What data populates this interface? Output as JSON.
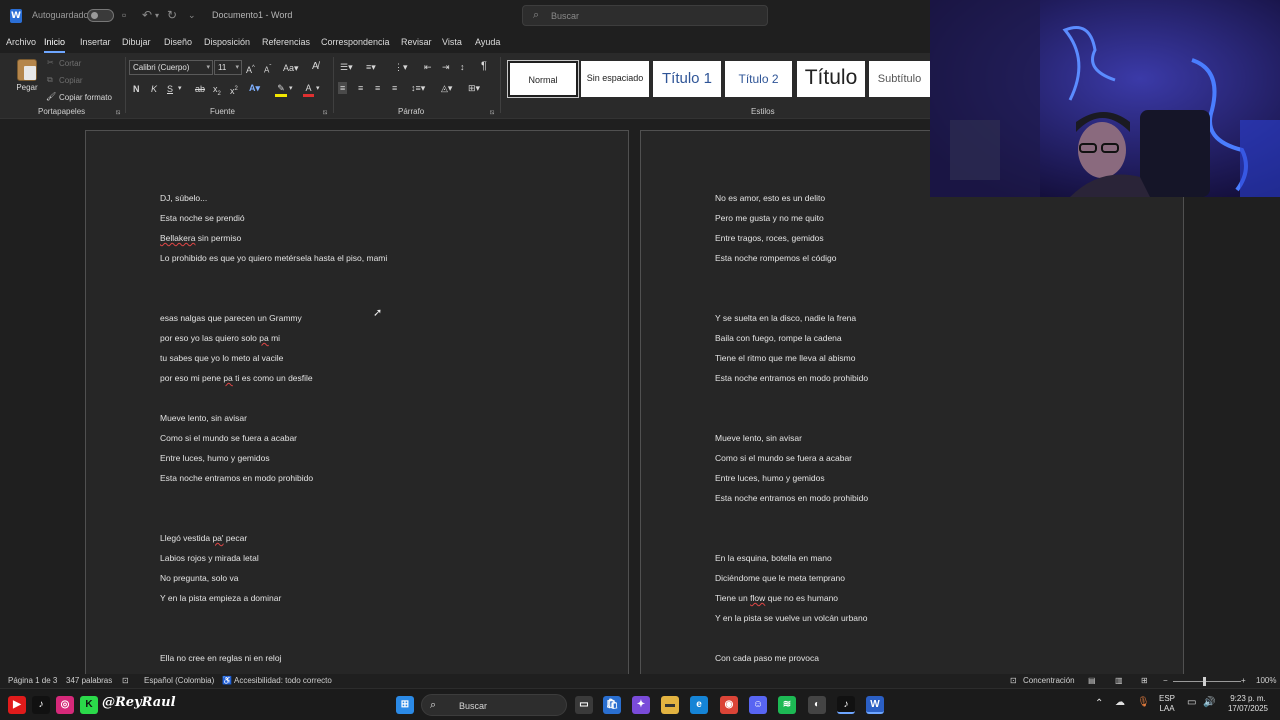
{
  "titlebar": {
    "autosave_label": "Autoguardado",
    "doc_title": "Documento1 - Word",
    "search_placeholder": "Buscar"
  },
  "menu": [
    "Archivo",
    "Inicio",
    "Insertar",
    "Dibujar",
    "Diseño",
    "Disposición",
    "Referencias",
    "Correspondencia",
    "Revisar",
    "Vista",
    "Ayuda"
  ],
  "menu_active": "Inicio",
  "ribbon": {
    "paste": "Pegar",
    "cut": "Cortar",
    "copy": "Copiar",
    "format_painter": "Copiar formato",
    "clipboard_group": "Portapapeles",
    "font_name": "Calibri (Cuerpo)",
    "font_size": "11",
    "font_group": "Fuente",
    "paragraph_group": "Párrafo",
    "styles_group": "Estilos",
    "styles": [
      "Normal",
      "Sin espaciado",
      "Título 1",
      "Título 2",
      "Título",
      "Subtítulo"
    ]
  },
  "document": {
    "page1": [
      "DJ, súbelo...",
      "Esta noche se prendió",
      "Bellakera sin permiso",
      "Lo prohibido es que yo quiero metérsela hasta el piso, mami",
      " esas nalgas que parecen un Grammy",
      "por eso yo las quiero solo pa mi",
      "tu sabes que yo lo meto al vacile",
      "por eso mi pene pa ti es como un desfile",
      "Mueve lento, sin avisar",
      "Como si el mundo se fuera a acabar",
      "Entre luces, humo y gemidos",
      "Esta noche entramos en modo prohibido",
      "Llegó vestida pa' pecar",
      "Labios rojos y mirada letal",
      "No pregunta, solo va",
      "Y en la pista empieza a dominar",
      "Ella no cree en reglas ni en reloj"
    ],
    "page2": [
      "No es amor, esto es un delito",
      "Pero me gusta y no me quito",
      "Entre tragos, roces, gemidos",
      "Esta noche rompemos el código",
      "Y se suelta en la disco, nadie la frena",
      "Baila con fuego, rompe la cadena",
      "Tiene el ritmo que me lleva al abismo",
      "Esta noche entramos en modo prohibido",
      "Mueve lento, sin avisar",
      "Como si el mundo se fuera a acabar",
      "Entre luces, humo y gemidos",
      "Esta noche entramos en modo prohibido",
      "En la esquina, botella en mano",
      "Diciéndome que le meta temprano",
      "Tiene un flow que no es humano",
      "Y en la pista se vuelve un volcán urbano",
      "Con cada paso me provoca"
    ]
  },
  "status": {
    "page": "Página 1 de 3",
    "words": "347 palabras",
    "language": "Español (Colombia)",
    "accessibility": "Accesibilidad: todo correcto",
    "focus": "Concentración",
    "zoom": "100%"
  },
  "taskbar": {
    "overlay_handle": "@ReyRaul",
    "search_placeholder": "Buscar",
    "lang_top": "ESP",
    "lang_bottom": "LAA",
    "time": "9:23 p. m.",
    "date": "17/07/2025"
  },
  "colors": {
    "ribbon_bg": "#2a2a2a",
    "page_bg": "#262626",
    "accent": "#6ea6ff",
    "spell_error": "#e04646"
  }
}
